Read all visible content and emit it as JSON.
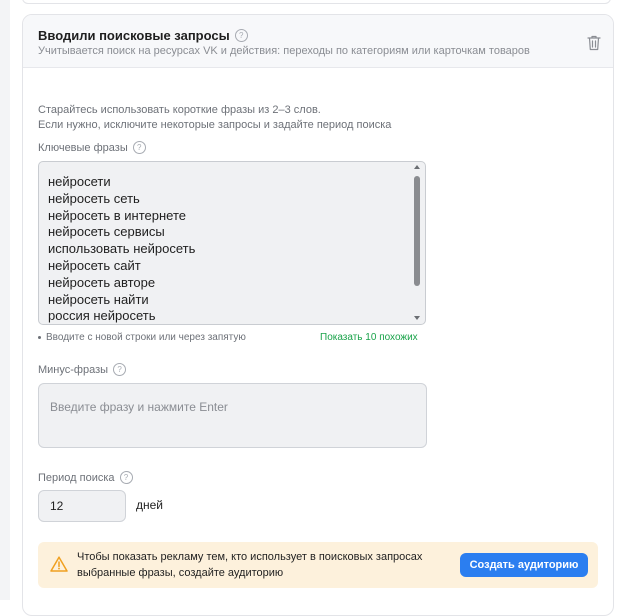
{
  "card": {
    "title": "Вводили поисковые запросы",
    "subtitle": "Учитывается поиск на ресурсах VK и действия: переходы по категориям или карточкам товаров",
    "delete_icon": "trash-icon"
  },
  "hint": {
    "line1": "Старайтесь использовать короткие фразы из 2–3 слов.",
    "line2": "Если нужно, исключите некоторые запросы и задайте период поиска"
  },
  "keywords": {
    "label": "Ключевые фразы",
    "items": [
      "нейросети",
      "нейросеть сеть",
      "нейросеть в интернете",
      "нейросеть сервисы",
      "использовать нейросеть",
      "нейросеть сайт",
      "нейросеть авторе",
      "нейросеть найти",
      "россия нейросеть"
    ],
    "input_hint": "Вводите с новой строки или через запятую",
    "similar_link": "Показать 10 похожих"
  },
  "minus": {
    "label": "Минус-фразы",
    "placeholder": "Введите фразу и нажмите Enter"
  },
  "period": {
    "label": "Период поиска",
    "value": "12",
    "unit": "дней"
  },
  "warning": {
    "text": "Чтобы показать рекламу тем, кто использует в поисковых запросах выбранные фразы, создайте аудиторию",
    "button_label": "Создать аудиторию",
    "icon": "warning-triangle-icon"
  },
  "help_icon_glyph": "?",
  "colors": {
    "accent": "#2b7ef0",
    "link_green": "#1aa34a",
    "warning_bg": "#fdf1dc",
    "warning_icon": "#f0a020"
  }
}
